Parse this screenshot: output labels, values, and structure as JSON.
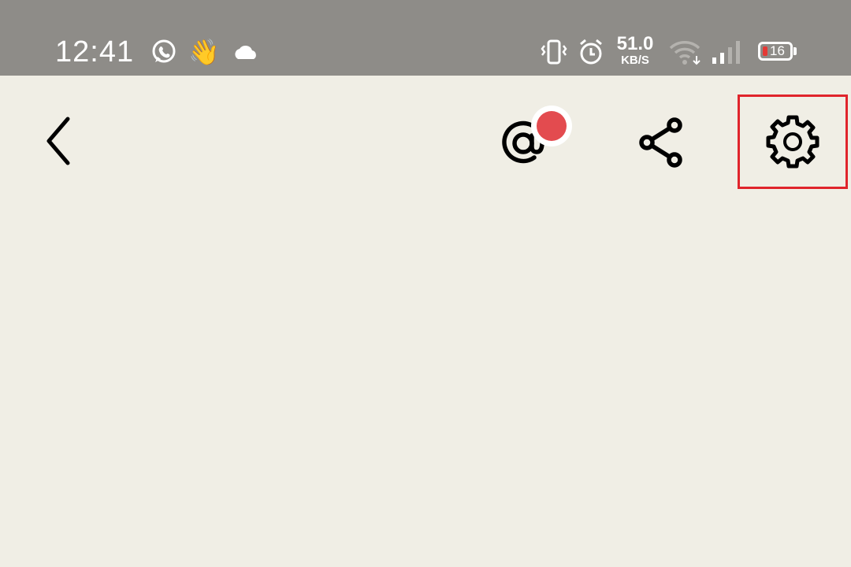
{
  "status_bar": {
    "time": "12:41",
    "net_speed_value": "51.0",
    "net_speed_unit": "KB/S",
    "battery_level": "16",
    "icons": [
      "whatsapp-icon",
      "waving-hand-icon",
      "cloud-icon",
      "vibrate-icon",
      "alarm-icon",
      "wifi-icon",
      "signal-icon",
      "battery-icon"
    ]
  },
  "toolbar": {
    "icons": [
      "back-arrow-icon",
      "mention-icon",
      "share-icon",
      "gear-icon"
    ],
    "mention_has_notification": true,
    "highlight_color": "#e0242b"
  },
  "colors": {
    "status_bar_bg": "#8e8c88",
    "page_bg": "#f0eee5",
    "badge": "#e34b4f"
  }
}
